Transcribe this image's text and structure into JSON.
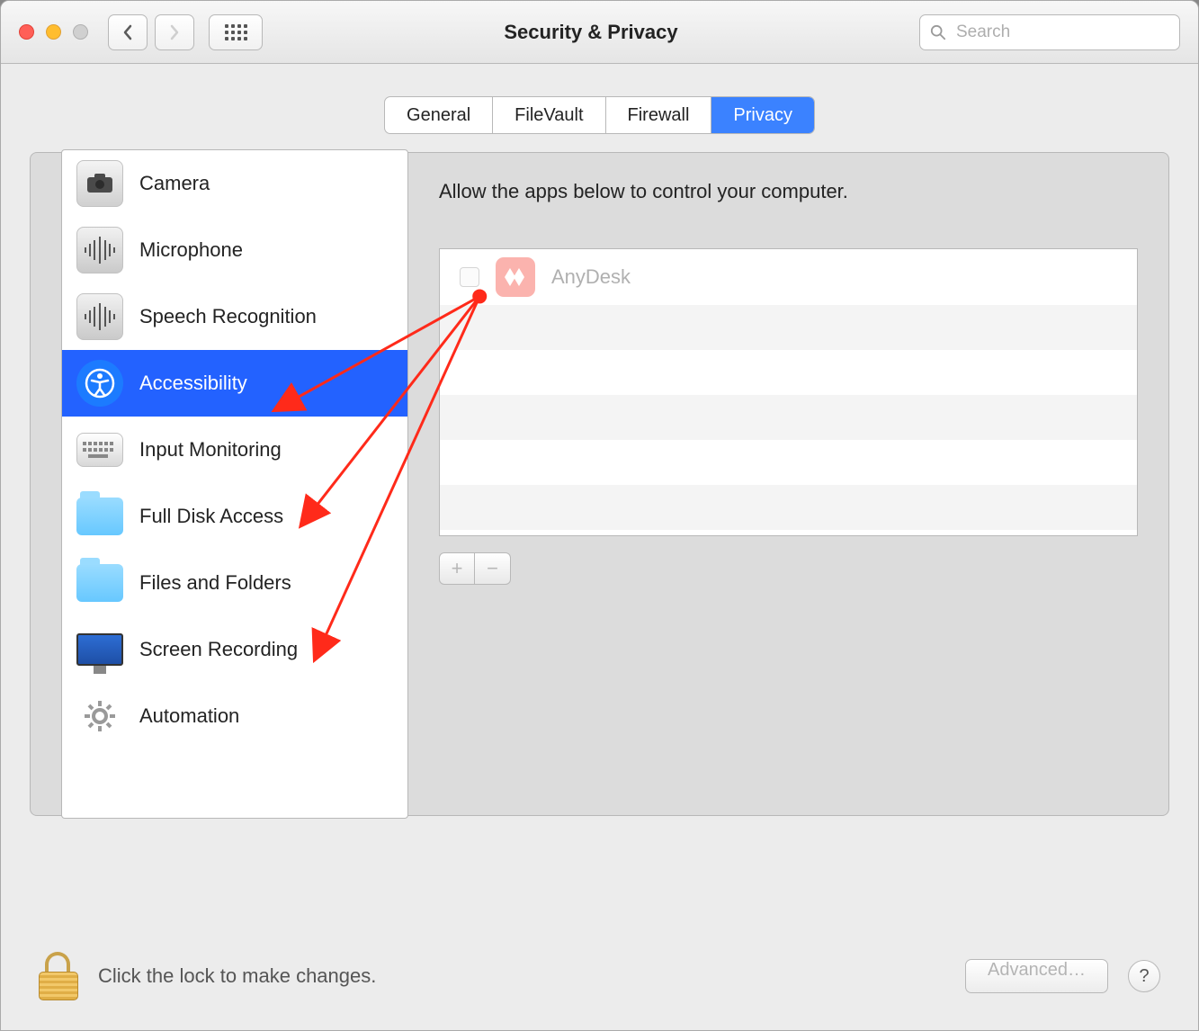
{
  "window": {
    "title": "Security & Privacy"
  },
  "search": {
    "placeholder": "Search"
  },
  "tabs": [
    {
      "label": "General"
    },
    {
      "label": "FileVault"
    },
    {
      "label": "Firewall"
    },
    {
      "label": "Privacy",
      "active": true
    }
  ],
  "sidebar": {
    "items": [
      {
        "label": "Camera",
        "icon": "camera"
      },
      {
        "label": "Microphone",
        "icon": "microphone"
      },
      {
        "label": "Speech Recognition",
        "icon": "waveform"
      },
      {
        "label": "Accessibility",
        "icon": "accessibility",
        "selected": true
      },
      {
        "label": "Input Monitoring",
        "icon": "keyboard"
      },
      {
        "label": "Full Disk Access",
        "icon": "folder"
      },
      {
        "label": "Files and Folders",
        "icon": "folder"
      },
      {
        "label": "Screen Recording",
        "icon": "display"
      },
      {
        "label": "Automation",
        "icon": "gear"
      }
    ]
  },
  "detail": {
    "heading": "Allow the apps below to control your computer.",
    "apps": [
      {
        "name": "AnyDesk",
        "checked": false,
        "icon": "anydesk",
        "icon_color": "#f5a29c"
      }
    ],
    "add_label": "+",
    "remove_label": "−"
  },
  "footer": {
    "lock_text": "Click the lock to make changes.",
    "advanced_label": "Advanced…",
    "help_label": "?"
  },
  "annotation": {
    "color": "#ff2a1a",
    "origin_desc": "AnyDesk checkbox",
    "targets": [
      "Accessibility",
      "Full Disk Access",
      "Screen Recording"
    ]
  }
}
